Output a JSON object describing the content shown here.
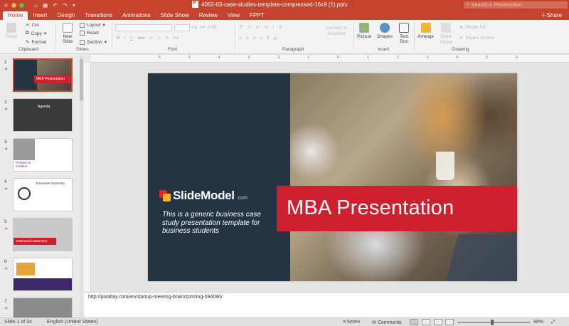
{
  "window": {
    "title": "4062-03-case-studies-template-compressed-16x9 (1).pptx",
    "search_placeholder": "Search in Presentation"
  },
  "tabs": [
    "Home",
    "Insert",
    "Design",
    "Transitions",
    "Animations",
    "Slide Show",
    "Review",
    "View",
    "FPPT"
  ],
  "share_label": "Share",
  "ribbon": {
    "clipboard": {
      "paste": "Paste",
      "cut": "Cut",
      "copy": "Copy",
      "format": "Format",
      "group": "Clipboard"
    },
    "slides": {
      "new_slide": "New Slide",
      "layout": "Layout",
      "reset": "Reset",
      "section": "Section",
      "group": "Slides"
    },
    "font": {
      "group": "Font"
    },
    "paragraph": {
      "group": "Paragraph",
      "convert": "Convert to SmartArt"
    },
    "insert": {
      "picture": "Picture",
      "shapes": "Shapes",
      "textbox": "Text Box",
      "group": "Insert"
    },
    "drawing": {
      "arrange": "Arrange",
      "quick_styles": "Quick Styles",
      "shape_fill": "Shape Fill",
      "shape_outline": "Shape Outline",
      "group": "Drawing"
    }
  },
  "thumbnails": [
    {
      "num": "1",
      "caption": "MBA Presentation"
    },
    {
      "num": "2",
      "caption": "Agenda"
    },
    {
      "num": "3",
      "caption": "Problem & Solution"
    },
    {
      "num": "4",
      "caption": "Executive Summary"
    },
    {
      "num": "5",
      "caption": "Testimonial Statement"
    },
    {
      "num": "6",
      "caption": ""
    },
    {
      "num": "7",
      "caption": ""
    }
  ],
  "slide": {
    "logo_text": "SlideModel",
    "logo_domain": ".com",
    "subtitle": "This is a generic business case study presentation template for business students",
    "title": "MBA Presentation"
  },
  "notes_text": "http://pixabay.com/en/startup-meeting-brainstorming-594090/",
  "status": {
    "slide_info": "Slide 1 of 34",
    "language": "English (United States)",
    "notes": "Notes",
    "comments": "Comments",
    "zoom": "98%"
  },
  "ruler_labels": [
    "6",
    "5",
    "4",
    "3",
    "2",
    "1",
    "0",
    "1",
    "2",
    "3",
    "4",
    "5",
    "6"
  ]
}
